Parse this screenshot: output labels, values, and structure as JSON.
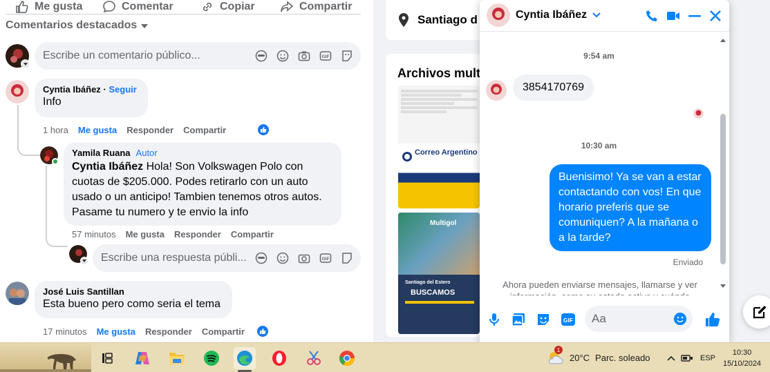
{
  "post_actions": {
    "like": "Me gusta",
    "comment": "Comentar",
    "copy": "Copiar",
    "share": "Compartir"
  },
  "featured_label": "Comentarios destacados",
  "comment_input_placeholder": "Escribe un comentario público...",
  "comments": [
    {
      "author": "Cyntia Ibáñez",
      "follow": "Seguir",
      "text": "Info",
      "time": "1 hora",
      "like": "Me gusta",
      "reply": "Responder",
      "share": "Compartir"
    },
    {
      "author": "Yamila Ruana",
      "badge": "Autor",
      "mention": "Cyntia Ibáñez",
      "text": "Hola! Son Volkswagen Polo con cuotas de $205.000. Podes retirarlo con un auto usado o un anticipo! Tambien tenemos otros autos. Pasame tu numero y te envio la info",
      "time": "57 minutos",
      "like": "Me gusta",
      "reply": "Responder",
      "share": "Compartir"
    },
    {
      "author": "José Luis Santillan",
      "text": "Esta bueno pero como seria el tema",
      "time": "17 minutos",
      "like": "Me gusta",
      "reply": "Responder",
      "share": "Compartir"
    }
  ],
  "reply_input_placeholder": "Escribe una respuesta públi...",
  "right_column": {
    "location": "Santiago d",
    "files_title": "Archivos multi"
  },
  "chat": {
    "contact_name": "Cyntia Ibáñez",
    "time1": "9:54 am",
    "incoming_message": "3854170769",
    "time2": "10:30 am",
    "outgoing_message": "Buenisimo! Ya se van a estar contactando con vos! En que horario preferis que se comuniquen? A la mañana o a la tarde?",
    "status": "Enviado",
    "notice": "Ahora pueden enviarse mensajes, llamarse y ver información, como su estado activo y cuándo",
    "composer_placeholder": "Aa"
  },
  "thumb1": {
    "brand": "Correo Argentino"
  },
  "thumb2": {
    "brand": "Multigol",
    "line1": "Santiago del Estero",
    "line2": "BUSCAMOS"
  },
  "taskbar": {
    "weather": "20°C",
    "weather_text": "Parc. soleado",
    "lang": "ESP",
    "time": "10:30",
    "date": "15/10/2024"
  },
  "colors": {
    "fb_blue": "#1877f2",
    "messenger_blue": "#0084ff",
    "muted": "#65676b"
  }
}
